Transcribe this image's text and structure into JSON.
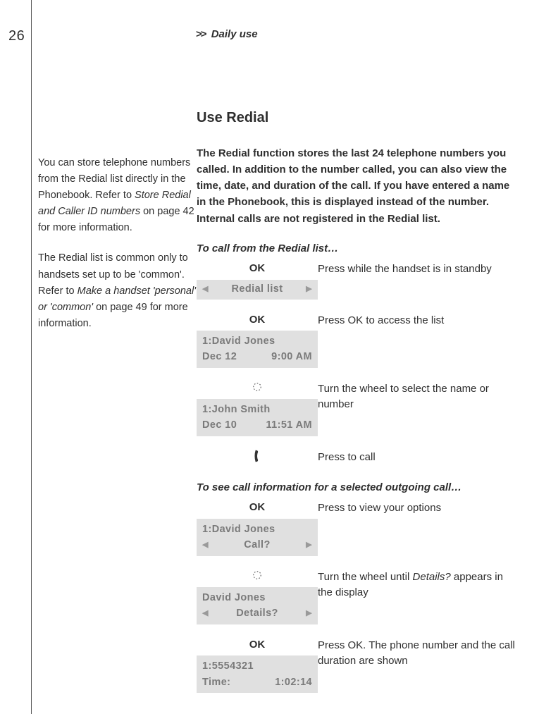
{
  "page_number": "26",
  "header_prefix": ">>",
  "header_title": "Daily use",
  "sidebar": {
    "p1a": "You can store telephone numbers from the Redial list directly in the Phonebook. Refer to ",
    "p1_it": "Store Redial and Caller ID numbers",
    "p1b": " on page 42 for more information.",
    "p2a": "The Redial list is common only to handsets set up to be 'common'. Refer to ",
    "p2_it": "Make a handset 'personal' or 'common'",
    "p2b": " on page 49 for more information."
  },
  "main": {
    "section_title": "Use Redial",
    "intro": "The Redial function stores the last 24 telephone numbers you called. In addition to the number called, you can also view the time, date, and duration of the call. If you have entered a name in the Phonebook, this is displayed instead of the number. Internal calls are not registered in the Redial list.",
    "sub1": "To call from the Redial list…",
    "sub2": "To see call information for a selected outgoing call…",
    "ok_label": "OK",
    "tri_left": "◀",
    "tri_right": "▶",
    "steps1": {
      "s1": {
        "display_center": "Redial list",
        "desc": "Press while the handset is in standby"
      },
      "s2": {
        "disp_l1": "1:David Jones",
        "disp_l2a": "Dec 12",
        "disp_l2b": "9:00 AM",
        "desc": "Press OK to access the list"
      },
      "s3": {
        "disp_l1": "1:John Smith",
        "disp_l2a": "Dec 10",
        "disp_l2b": "11:51 AM",
        "desc": "Turn the wheel to select the name or number"
      },
      "s4": {
        "desc": "Press to call"
      }
    },
    "steps2": {
      "s1": {
        "disp_l1": "1:David Jones",
        "disp_center": "Call?",
        "desc": "Press to view your options"
      },
      "s2": {
        "disp_l1": "David Jones",
        "disp_center": "Details?",
        "desc_a": "Turn the wheel until ",
        "desc_it": "Details?",
        "desc_b": " appears in the display"
      },
      "s3": {
        "disp_l1": "1:5554321",
        "disp_l2a": "Time:",
        "disp_l2b": "1:02:14",
        "desc": "Press OK. The phone number and the call duration are shown"
      }
    }
  }
}
